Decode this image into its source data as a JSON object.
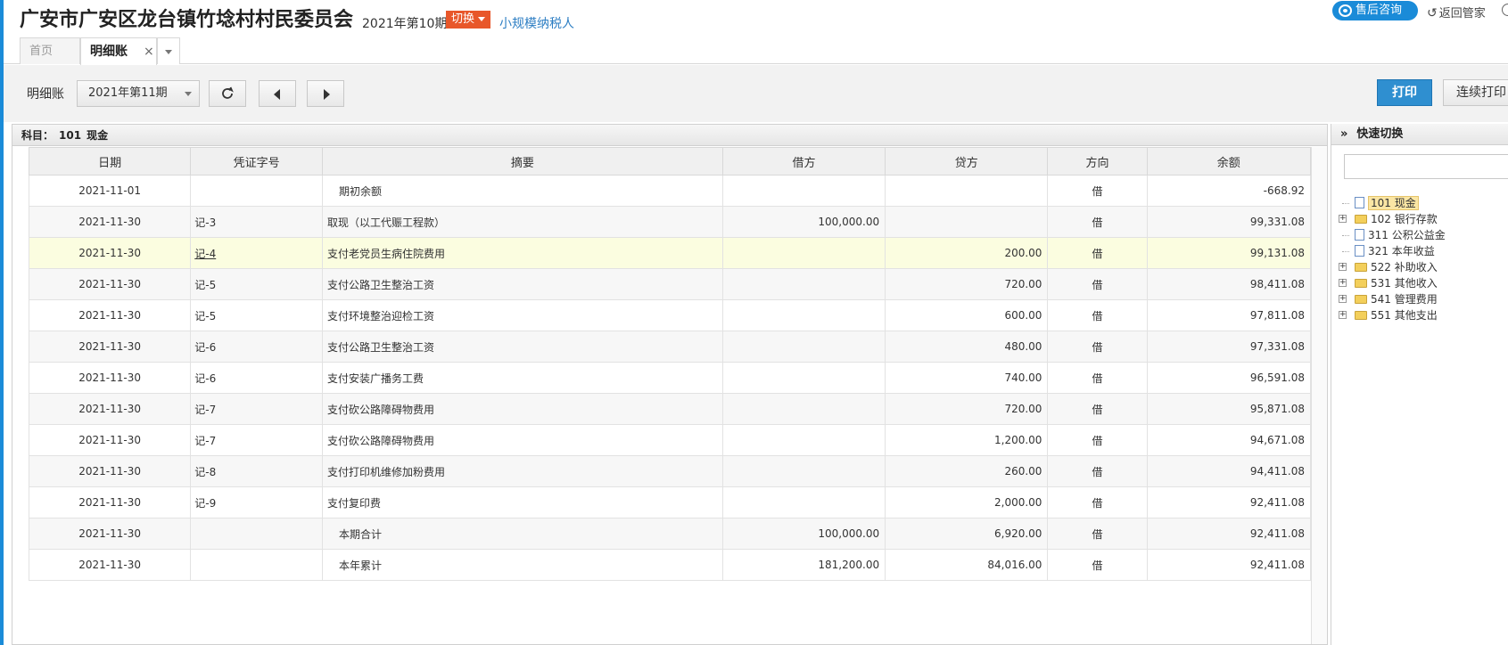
{
  "header": {
    "company": "广安市广安区龙台镇竹埝村村民委员会",
    "period": "2021年第10期",
    "switch_label": "切换",
    "taxpayer_type": "小规模纳税人",
    "service_label": "售后咨询",
    "return_label": "返回管家"
  },
  "tabs": {
    "home": "首页",
    "active": "明细账",
    "close": "×"
  },
  "toolbar": {
    "label": "明细账",
    "period_selected": "2021年第11期",
    "print_label": "打印",
    "continuous_print_label": "连续打印"
  },
  "subject": {
    "prefix": "科目：",
    "code": "101",
    "name": "现金"
  },
  "columns": [
    "日期",
    "凭证字号",
    "摘要",
    "借方",
    "贷方",
    "方向",
    "余额"
  ],
  "rows": [
    {
      "date": "2021-11-01",
      "voucher": "",
      "summary": "期初余额",
      "debit": "",
      "credit": "",
      "dir": "借",
      "balance": "-668.92",
      "indent": true
    },
    {
      "date": "2021-11-30",
      "voucher": "记-3",
      "summary": "取现（以工代赈工程款）",
      "debit": "100,000.00",
      "credit": "",
      "dir": "借",
      "balance": "99,331.08"
    },
    {
      "date": "2021-11-30",
      "voucher": "记-4",
      "summary": "支付老党员生病住院费用",
      "debit": "",
      "credit": "200.00",
      "dir": "借",
      "balance": "99,131.08",
      "highlight": true,
      "link": true
    },
    {
      "date": "2021-11-30",
      "voucher": "记-5",
      "summary": "支付公路卫生整治工资",
      "debit": "",
      "credit": "720.00",
      "dir": "借",
      "balance": "98,411.08"
    },
    {
      "date": "2021-11-30",
      "voucher": "记-5",
      "summary": "支付环境整治迎检工资",
      "debit": "",
      "credit": "600.00",
      "dir": "借",
      "balance": "97,811.08"
    },
    {
      "date": "2021-11-30",
      "voucher": "记-6",
      "summary": "支付公路卫生整治工资",
      "debit": "",
      "credit": "480.00",
      "dir": "借",
      "balance": "97,331.08"
    },
    {
      "date": "2021-11-30",
      "voucher": "记-6",
      "summary": "支付安装广播务工费",
      "debit": "",
      "credit": "740.00",
      "dir": "借",
      "balance": "96,591.08"
    },
    {
      "date": "2021-11-30",
      "voucher": "记-7",
      "summary": "支付砍公路障碍物费用",
      "debit": "",
      "credit": "720.00",
      "dir": "借",
      "balance": "95,871.08"
    },
    {
      "date": "2021-11-30",
      "voucher": "记-7",
      "summary": "支付砍公路障碍物费用",
      "debit": "",
      "credit": "1,200.00",
      "dir": "借",
      "balance": "94,671.08"
    },
    {
      "date": "2021-11-30",
      "voucher": "记-8",
      "summary": "支付打印机维修加粉费用",
      "debit": "",
      "credit": "260.00",
      "dir": "借",
      "balance": "94,411.08"
    },
    {
      "date": "2021-11-30",
      "voucher": "记-9",
      "summary": "支付复印费",
      "debit": "",
      "credit": "2,000.00",
      "dir": "借",
      "balance": "92,411.08"
    },
    {
      "date": "2021-11-30",
      "voucher": "",
      "summary": "本期合计",
      "debit": "100,000.00",
      "credit": "6,920.00",
      "dir": "借",
      "balance": "92,411.08",
      "indent": true
    },
    {
      "date": "2021-11-30",
      "voucher": "",
      "summary": "本年累计",
      "debit": "181,200.00",
      "credit": "84,016.00",
      "dir": "借",
      "balance": "92,411.08",
      "indent": true
    }
  ],
  "quick_switch": {
    "title": "快速切换",
    "items": [
      {
        "code": "101",
        "name": "现金",
        "type": "file",
        "selected": true
      },
      {
        "code": "102",
        "name": "银行存款",
        "type": "folder",
        "expandable": true
      },
      {
        "code": "311",
        "name": "公积公益金",
        "type": "file"
      },
      {
        "code": "321",
        "name": "本年收益",
        "type": "file"
      },
      {
        "code": "522",
        "name": "补助收入",
        "type": "folder",
        "expandable": true
      },
      {
        "code": "531",
        "name": "其他收入",
        "type": "folder",
        "expandable": true
      },
      {
        "code": "541",
        "name": "管理费用",
        "type": "folder",
        "expandable": true
      },
      {
        "code": "551",
        "name": "其他支出",
        "type": "folder",
        "expandable": true
      }
    ]
  },
  "colors": {
    "accent": "#1a8bd8",
    "switch": "#e8572a",
    "highlight_row": "#fbfde0",
    "link": "#2d7ec3"
  }
}
